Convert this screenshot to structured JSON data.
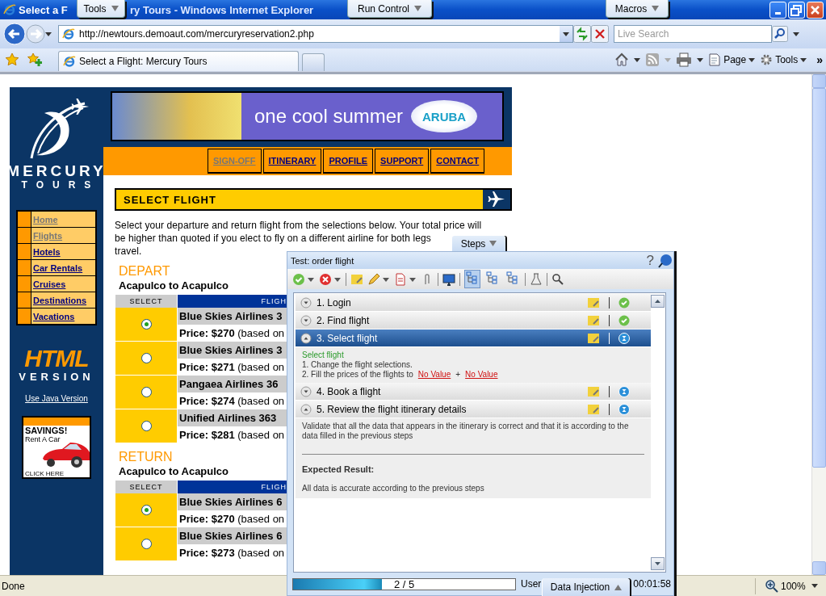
{
  "window": {
    "title_parts": [
      "Select a F",
      "ry Tours - Windows Internet Explorer"
    ]
  },
  "overlay_tabs": [
    {
      "label": "Tools"
    },
    {
      "label": "Run Control"
    },
    {
      "label": "Macros"
    }
  ],
  "address_bar": {
    "url": "http://newtours.demoaut.com/mercuryreservation2.php"
  },
  "search": {
    "placeholder": "Live Search"
  },
  "tabs": [
    {
      "label": "Select a Flight: Mercury Tours",
      "selected": true
    }
  ],
  "command_bar": [
    {
      "label": "Page"
    },
    {
      "label": "Tools"
    }
  ],
  "command_chevron": "»",
  "site": {
    "logo": {
      "line1": "MERCURY",
      "line2": "TOURS"
    },
    "banner": {
      "tagline": "one cool summer",
      "brand": "ARUBA"
    },
    "top_nav": [
      {
        "label": "SIGN-OFF",
        "visited": true
      },
      {
        "label": "ITINERARY",
        "visited": false
      },
      {
        "label": "PROFILE",
        "visited": false
      },
      {
        "label": "SUPPORT",
        "visited": false
      },
      {
        "label": "CONTACT",
        "visited": false
      }
    ],
    "side_nav": [
      {
        "label": "Home",
        "visited": true
      },
      {
        "label": "Flights",
        "visited": true
      },
      {
        "label": "Hotels",
        "visited": false
      },
      {
        "label": "Car Rentals",
        "visited": false
      },
      {
        "label": "Cruises",
        "visited": false
      },
      {
        "label": "Destinations",
        "visited": false
      },
      {
        "label": "Vacations",
        "visited": false
      }
    ],
    "html_version": {
      "line1": "HTML",
      "line2": "VERSION"
    },
    "java_link": "Use Java Version",
    "ad": {
      "title": "SAVINGS!",
      "subtitle": "Rent A Car",
      "cta": "CLICK HERE"
    },
    "page_title": "SELECT FLIGHT",
    "intro_lines": [
      "Select your departure and return flight from the selections below. Your total price will",
      "be higher than quoted if you elect to fly on a different airline for both legs",
      "travel."
    ],
    "sections": [
      {
        "heading": "DEPART",
        "route": "Acapulco to Acapulco",
        "columns": [
          "SELECT",
          "FLIGH"
        ],
        "flights": [
          {
            "name": "Blue Skies Airlines 3",
            "price": "**Price: $270** (based on",
            "selected": true
          },
          {
            "name": "Blue Skies Airlines 3",
            "price": "**Price: $271** (based on",
            "selected": false
          },
          {
            "name": "Pangaea Airlines 36",
            "price": "**Price: $274** (based on",
            "selected": false
          },
          {
            "name": "Unified Airlines 363",
            "price": "**Price: $281** (based on",
            "selected": false
          }
        ]
      },
      {
        "heading": "RETURN",
        "route": "Acapulco to Acapulco",
        "columns": [
          "SELECT",
          "FLIGH"
        ],
        "flights": [
          {
            "name": "Blue Skies Airlines 6",
            "price": "**Price: $270** (based on",
            "selected": true
          },
          {
            "name": "Blue Skies Airlines 6",
            "price": "**Price: $273** (based on",
            "selected": false
          }
        ]
      }
    ]
  },
  "steps_panel": {
    "tab_label": "Steps",
    "title": "Test: order flight",
    "help_glyph": "?",
    "view_toggles": [
      {
        "selected": true
      },
      {
        "selected": false
      },
      {
        "selected": false
      }
    ],
    "steps": [
      {
        "title": "1. Login",
        "passed": true,
        "selected": false,
        "expanded": false
      },
      {
        "title": "2. Find flight",
        "passed": true,
        "selected": false,
        "expanded": false
      },
      {
        "title": "3. Select flight",
        "passed": false,
        "selected": true,
        "expanded": true,
        "details": {
          "kind": "instructions",
          "heading": "Select flight",
          "lines": [
            "1. Change the flight selections."
          ],
          "fill_text": "2. Fill the prices of the flights  to",
          "values": [
            "No Value",
            "No Value"
          ],
          "joiner": "+"
        }
      },
      {
        "title": "4. Book a flight",
        "passed": false,
        "selected": false,
        "expanded": false
      },
      {
        "title": "5. Review the flight itinerary details",
        "passed": false,
        "selected": false,
        "expanded": true,
        "details": {
          "kind": "description",
          "description": "Validate that all the data that appears in the itinerary is correct and that it is according to the data filled in the previous steps",
          "expected_label": "Expected Result:",
          "expected": "All data is accurate according to the previous steps"
        }
      }
    ],
    "progress": {
      "level": 0.4,
      "text": "2 / 5"
    },
    "user_label": "User",
    "data_injection_tab": "Data Injection",
    "timer": "00:01:58"
  },
  "status_bar": {
    "text": "Done",
    "zoom": "100%"
  }
}
